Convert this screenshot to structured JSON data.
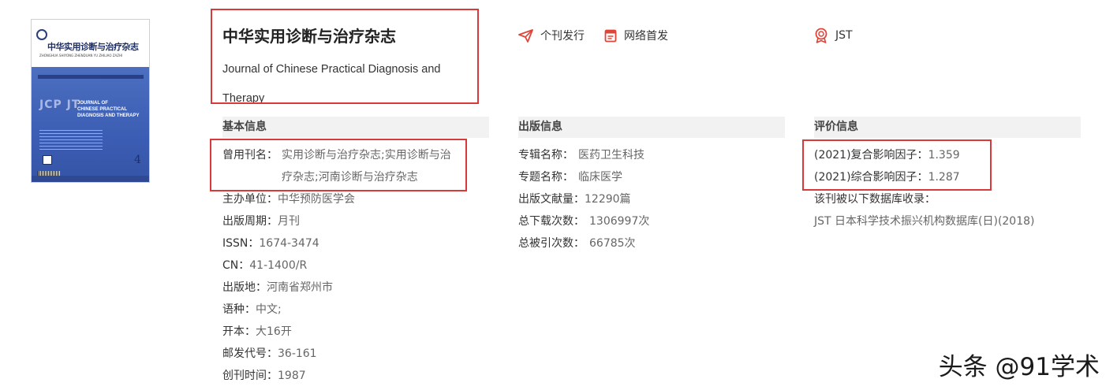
{
  "cover": {
    "title_cn": "中华实用诊断与治疗杂志",
    "pinyin": "ZHONGHUA SHIYONG ZHENDUAN YU ZHILIAO ZAZHI",
    "jcp": "JCP JT",
    "title_en": "JOURNAL OF\nCHINESE PRACTICAL\nDIAGNOSIS AND THERAPY",
    "issue": "4"
  },
  "journal": {
    "title_cn": "中华实用诊断与治疗杂志",
    "title_en": "Journal of Chinese Practical Diagnosis and Therapy"
  },
  "tags": [
    {
      "label": "个刊发行",
      "icon": "send-icon"
    },
    {
      "label": "网络首发",
      "icon": "document-icon"
    },
    {
      "label": "JST",
      "icon": "award-icon"
    }
  ],
  "basic": {
    "header": "基本信息",
    "former_names_label": "曾用刊名：",
    "former_names_value": "实用诊断与治疗杂志;实用诊断与治疗杂志;河南诊断与治疗杂志",
    "rows": [
      {
        "label": "主办单位：",
        "value": "中华预防医学会"
      },
      {
        "label": "出版周期：",
        "value": "月刊"
      },
      {
        "label": "ISSN：",
        "value": "1674-3474"
      },
      {
        "label": "CN：",
        "value": "41-1400/R"
      },
      {
        "label": "出版地：",
        "value": "河南省郑州市"
      },
      {
        "label": "语种：",
        "value": "中文;"
      },
      {
        "label": "开本：",
        "value": "大16开"
      },
      {
        "label": "邮发代号：",
        "value": "36-161"
      },
      {
        "label": "创刊时间：",
        "value": "1987"
      }
    ]
  },
  "publish": {
    "header": "出版信息",
    "rows": [
      {
        "label": "专辑名称：",
        "value": "医药卫生科技"
      },
      {
        "label": "专题名称：",
        "value": "临床医学"
      },
      {
        "label": "出版文献量：",
        "value": "12290篇"
      },
      {
        "label": "总下载次数：",
        "value": "1306997次"
      },
      {
        "label": "总被引次数：",
        "value": "66785次"
      }
    ]
  },
  "evaluation": {
    "header": "评价信息",
    "rows": [
      {
        "label": "(2021)复合影响因子：",
        "value": "1.359"
      },
      {
        "label": "(2021)综合影响因子：",
        "value": "1.287"
      }
    ],
    "db_label": "该刊被以下数据库收录：",
    "db_value": "JST 日本科学技术振兴机构数据库(日)(2018)"
  },
  "watermark": "头条 @91学术",
  "colors": {
    "highlight_border": "#d83a3a",
    "section_bg": "#f2f2f2",
    "icon_red": "#e0453a"
  }
}
